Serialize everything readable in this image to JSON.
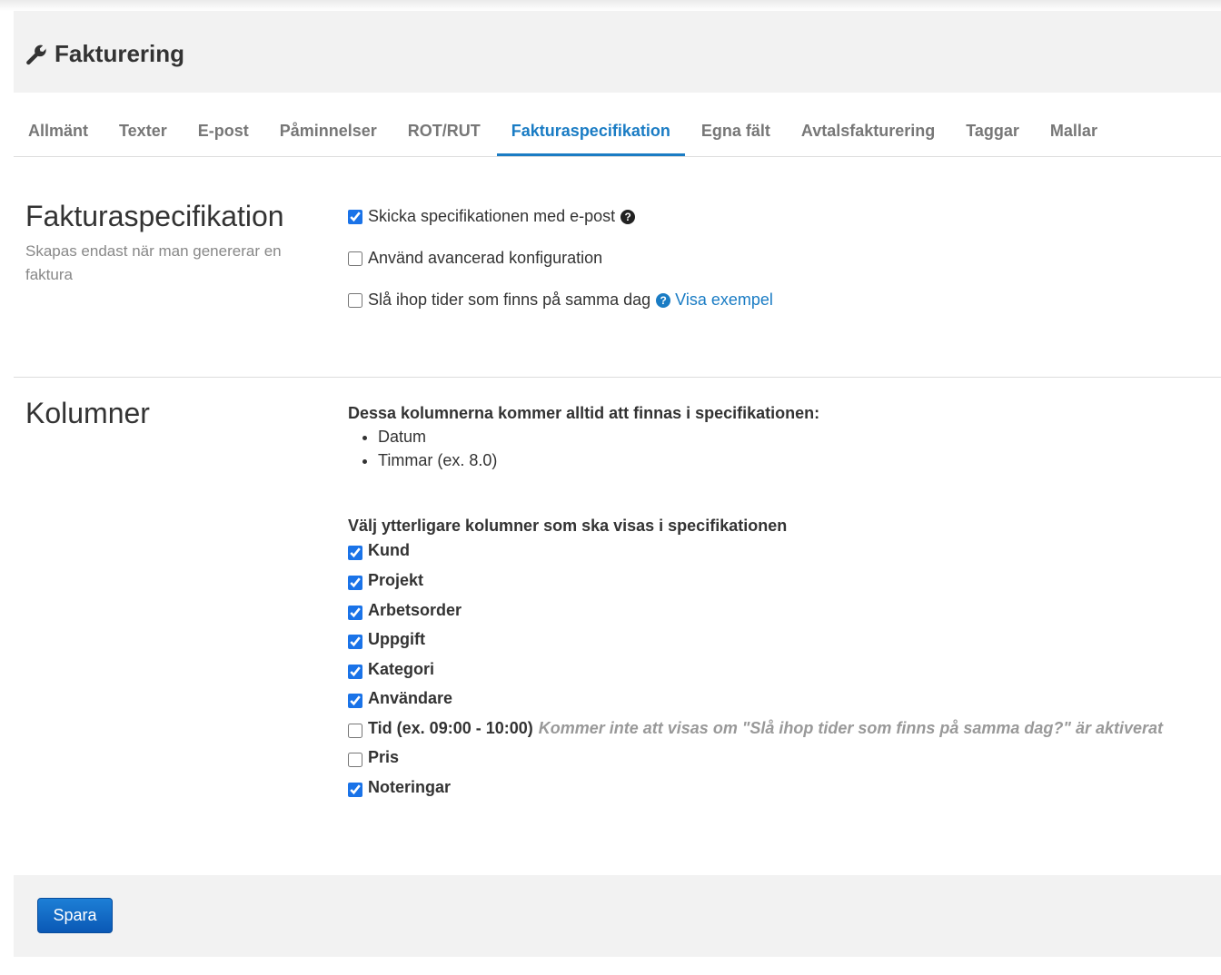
{
  "header": {
    "title": "Fakturering",
    "icon": "wrench-icon"
  },
  "tabs": [
    {
      "label": "Allmänt",
      "active": false
    },
    {
      "label": "Texter",
      "active": false
    },
    {
      "label": "E-post",
      "active": false
    },
    {
      "label": "Påminnelser",
      "active": false
    },
    {
      "label": "ROT/RUT",
      "active": false
    },
    {
      "label": "Fakturaspecifikation",
      "active": true
    },
    {
      "label": "Egna fält",
      "active": false
    },
    {
      "label": "Avtalsfakturering",
      "active": false
    },
    {
      "label": "Taggar",
      "active": false
    },
    {
      "label": "Mallar",
      "active": false
    }
  ],
  "spec": {
    "title": "Fakturaspecifikation",
    "subtitle": "Skapas endast när man genererar en faktura",
    "options": [
      {
        "label": "Skicka specifikationen med e-post",
        "checked": true
      },
      {
        "label": "Använd avancerad konfiguration",
        "checked": false
      },
      {
        "label": "Slå ihop tider som finns på samma dag",
        "checked": false,
        "link": "Visa exempel"
      }
    ]
  },
  "columns": {
    "title": "Kolumner",
    "fixed_heading": "Dessa kolumnerna kommer alltid att finnas i specifikationen:",
    "fixed_items": [
      "Datum",
      "Timmar (ex. 8.0)"
    ],
    "extra_heading": "Välj ytterligare kolumner som ska visas i specifikationen",
    "extra_items": [
      {
        "label": "Kund",
        "checked": true
      },
      {
        "label": "Projekt",
        "checked": true
      },
      {
        "label": "Arbetsorder",
        "checked": true
      },
      {
        "label": "Uppgift",
        "checked": true
      },
      {
        "label": "Kategori",
        "checked": true
      },
      {
        "label": "Användare",
        "checked": true
      },
      {
        "label": "Tid (ex. 09:00 - 10:00)",
        "checked": false,
        "note": "Kommer inte att visas om \"Slå ihop tider som finns på samma dag?\" är aktiverat"
      },
      {
        "label": "Pris",
        "checked": false
      },
      {
        "label": "Noteringar",
        "checked": true
      }
    ]
  },
  "footer": {
    "save_label": "Spara"
  },
  "colors": {
    "accent": "#1a7cc4",
    "button": "#0a58b5",
    "panel": "#f2f2f2"
  }
}
